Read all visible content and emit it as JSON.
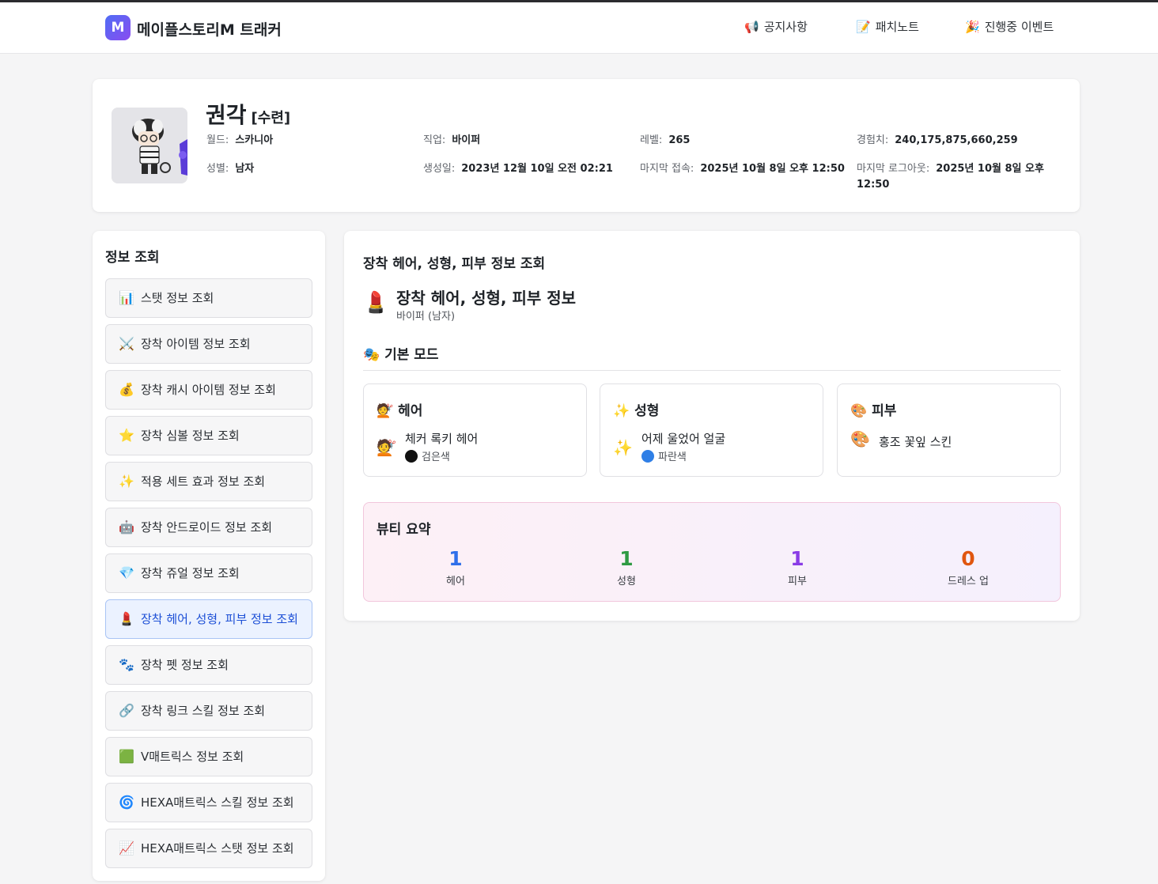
{
  "brand": {
    "logo_letter": "M",
    "name": "메이플스토리M 트래커"
  },
  "nav": [
    {
      "icon": "📢",
      "label": "공지사항"
    },
    {
      "icon": "📝",
      "label": "패치노트"
    },
    {
      "icon": "🎉",
      "label": "진행중 이벤트"
    }
  ],
  "character": {
    "name": "권각",
    "guild": "[수련]",
    "info": {
      "world": {
        "label": "월드:",
        "value": "스카니아"
      },
      "job": {
        "label": "직업:",
        "value": "바이퍼"
      },
      "level": {
        "label": "레벨:",
        "value": "265"
      },
      "exp": {
        "label": "경험치:",
        "value": "240,175,875,660,259"
      },
      "gender": {
        "label": "성별:",
        "value": "남자"
      },
      "created": {
        "label": "생성일:",
        "value": "2023년 12월 10일 오전 02:21"
      },
      "last_access": {
        "label": "마지막 접속:",
        "value": "2025년 10월 8일 오후 12:50"
      },
      "last_logout": {
        "label": "마지막 로그아웃:",
        "value": "2025년 10월 8일 오후 12:50"
      }
    }
  },
  "sidebar": {
    "title": "정보 조회",
    "items": [
      {
        "icon": "📊",
        "label": "스탯 정보 조회"
      },
      {
        "icon": "⚔️",
        "label": "장착 아이템 정보 조회"
      },
      {
        "icon": "💰",
        "label": "장착 캐시 아이템 정보 조회"
      },
      {
        "icon": "⭐",
        "label": "장착 심볼 정보 조회"
      },
      {
        "icon": "✨",
        "label": "적용 세트 효과 정보 조회"
      },
      {
        "icon": "🤖",
        "label": "장착 안드로이드 정보 조회"
      },
      {
        "icon": "💎",
        "label": "장착 쥬얼 정보 조회"
      },
      {
        "icon": "💄",
        "label": "장착 헤어, 성형, 피부 정보 조회"
      },
      {
        "icon": "🐾",
        "label": "장착 펫 정보 조회"
      },
      {
        "icon": "🔗",
        "label": "장착 링크 스킬 정보 조회"
      },
      {
        "icon": "🟩",
        "label": "V매트릭스 정보 조회"
      },
      {
        "icon": "🌀",
        "label": "HEXA매트릭스 스킬 정보 조회"
      },
      {
        "icon": "📈",
        "label": "HEXA매트릭스 스탯 정보 조회"
      }
    ],
    "active_index": 7
  },
  "main": {
    "title": "장착 헤어, 성형, 피부 정보 조회",
    "section": {
      "icon": "💄",
      "title": "장착 헤어, 성형, 피부 정보",
      "subtitle": "바이퍼 (남자)"
    },
    "mode_title": "🎭 기본 모드",
    "cards": [
      {
        "header": "💇 헤어",
        "icon": "💇",
        "name": "체커 록키 헤어",
        "color_label": "검은색",
        "color_hex": "#111111"
      },
      {
        "header": "✨ 성형",
        "icon": "✨",
        "name": "어제 울었어 얼굴",
        "color_label": "파란색",
        "color_hex": "#2f7fe6"
      },
      {
        "header": "🎨 피부",
        "icon": "🎨",
        "name": "홍조 꽃잎 스킨"
      }
    ],
    "summary": {
      "title": "뷰티 요약",
      "stats": [
        {
          "value": "1",
          "label": "헤어",
          "color": "#2f6fea"
        },
        {
          "value": "1",
          "label": "성형",
          "color": "#2e9a43"
        },
        {
          "value": "1",
          "label": "피부",
          "color": "#8a3ce6"
        },
        {
          "value": "0",
          "label": "드레스 업",
          "color": "#e0560f"
        }
      ]
    }
  }
}
